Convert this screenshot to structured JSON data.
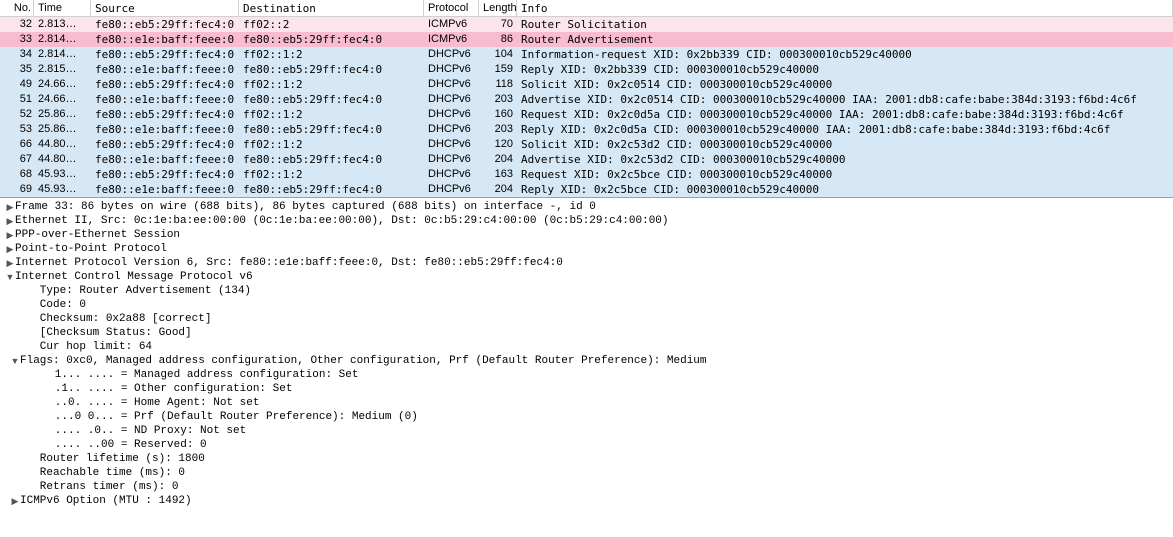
{
  "columns": [
    "No.",
    "Time",
    "Source",
    "Destination",
    "Protocol",
    "Length",
    "Info"
  ],
  "packets": [
    {
      "no": "32",
      "time": "2.813…",
      "src": "fe80::eb5:29ff:fec4:0",
      "dst": "ff02::2",
      "proto": "ICMPv6",
      "len": "70",
      "info": "Router Solicitation",
      "cls": "row-pink"
    },
    {
      "no": "33",
      "time": "2.814…",
      "src": "fe80::e1e:baff:feee:0",
      "dst": "fe80::eb5:29ff:fec4:0",
      "proto": "ICMPv6",
      "len": "86",
      "info": "Router Advertisement",
      "cls": "row-pinksel"
    },
    {
      "no": "34",
      "time": "2.814…",
      "src": "fe80::eb5:29ff:fec4:0",
      "dst": "ff02::1:2",
      "proto": "DHCPv6",
      "len": "104",
      "info": "Information-request XID: 0x2bb339 CID: 000300010cb529c40000",
      "cls": "row-blue"
    },
    {
      "no": "35",
      "time": "2.815…",
      "src": "fe80::e1e:baff:feee:0",
      "dst": "fe80::eb5:29ff:fec4:0",
      "proto": "DHCPv6",
      "len": "159",
      "info": "Reply XID: 0x2bb339 CID: 000300010cb529c40000",
      "cls": "row-blue"
    },
    {
      "no": "49",
      "time": "24.66…",
      "src": "fe80::eb5:29ff:fec4:0",
      "dst": "ff02::1:2",
      "proto": "DHCPv6",
      "len": "118",
      "info": "Solicit XID: 0x2c0514 CID: 000300010cb529c40000",
      "cls": "row-blue"
    },
    {
      "no": "51",
      "time": "24.66…",
      "src": "fe80::e1e:baff:feee:0",
      "dst": "fe80::eb5:29ff:fec4:0",
      "proto": "DHCPv6",
      "len": "203",
      "info": "Advertise XID: 0x2c0514 CID: 000300010cb529c40000 IAA: 2001:db8:cafe:babe:384d:3193:f6bd:4c6f",
      "cls": "row-blue"
    },
    {
      "no": "52",
      "time": "25.86…",
      "src": "fe80::eb5:29ff:fec4:0",
      "dst": "ff02::1:2",
      "proto": "DHCPv6",
      "len": "160",
      "info": "Request XID: 0x2c0d5a CID: 000300010cb529c40000 IAA: 2001:db8:cafe:babe:384d:3193:f6bd:4c6f",
      "cls": "row-blue"
    },
    {
      "no": "53",
      "time": "25.86…",
      "src": "fe80::e1e:baff:feee:0",
      "dst": "fe80::eb5:29ff:fec4:0",
      "proto": "DHCPv6",
      "len": "203",
      "info": "Reply XID: 0x2c0d5a CID: 000300010cb529c40000 IAA: 2001:db8:cafe:babe:384d:3193:f6bd:4c6f",
      "cls": "row-blue"
    },
    {
      "no": "66",
      "time": "44.80…",
      "src": "fe80::eb5:29ff:fec4:0",
      "dst": "ff02::1:2",
      "proto": "DHCPv6",
      "len": "120",
      "info": "Solicit XID: 0x2c53d2 CID: 000300010cb529c40000",
      "cls": "row-blue"
    },
    {
      "no": "67",
      "time": "44.80…",
      "src": "fe80::e1e:baff:feee:0",
      "dst": "fe80::eb5:29ff:fec4:0",
      "proto": "DHCPv6",
      "len": "204",
      "info": "Advertise XID: 0x2c53d2 CID: 000300010cb529c40000",
      "cls": "row-blue"
    },
    {
      "no": "68",
      "time": "45.93…",
      "src": "fe80::eb5:29ff:fec4:0",
      "dst": "ff02::1:2",
      "proto": "DHCPv6",
      "len": "163",
      "info": "Request XID: 0x2c5bce CID: 000300010cb529c40000",
      "cls": "row-blue"
    },
    {
      "no": "69",
      "time": "45.93…",
      "src": "fe80::e1e:baff:feee:0",
      "dst": "fe80::eb5:29ff:fec4:0",
      "proto": "DHCPv6",
      "len": "204",
      "info": "Reply XID: 0x2c5bce CID: 000300010cb529c40000",
      "cls": "row-blue"
    }
  ],
  "detail_lines": [
    {
      "lvl": 0,
      "tw": "▶",
      "txt": "Frame 33: 86 bytes on wire (688 bits), 86 bytes captured (688 bits) on interface -, id 0"
    },
    {
      "lvl": 0,
      "tw": "▶",
      "txt": "Ethernet II, Src: 0c:1e:ba:ee:00:00 (0c:1e:ba:ee:00:00), Dst: 0c:b5:29:c4:00:00 (0c:b5:29:c4:00:00)"
    },
    {
      "lvl": 0,
      "tw": "▶",
      "txt": "PPP-over-Ethernet Session"
    },
    {
      "lvl": 0,
      "tw": "▶",
      "txt": "Point-to-Point Protocol"
    },
    {
      "lvl": 0,
      "tw": "▶",
      "txt": "Internet Protocol Version 6, Src: fe80::e1e:baff:feee:0, Dst: fe80::eb5:29ff:fec4:0"
    },
    {
      "lvl": 0,
      "tw": "▼",
      "txt": "Internet Control Message Protocol v6"
    },
    {
      "lvl": 1,
      "tw": "",
      "txt": "   Type: Router Advertisement (134)"
    },
    {
      "lvl": 1,
      "tw": "",
      "txt": "   Code: 0"
    },
    {
      "lvl": 1,
      "tw": "",
      "txt": "   Checksum: 0x2a88 [correct]"
    },
    {
      "lvl": 1,
      "tw": "",
      "txt": "   [Checksum Status: Good]"
    },
    {
      "lvl": 1,
      "tw": "",
      "txt": "   Cur hop limit: 64"
    },
    {
      "lvl": 1,
      "tw": "▼",
      "txt": "Flags: 0xc0, Managed address configuration, Other configuration, Prf (Default Router Preference): Medium"
    },
    {
      "lvl": 2,
      "tw": "",
      "txt": "   1... .... = Managed address configuration: Set"
    },
    {
      "lvl": 2,
      "tw": "",
      "txt": "   .1.. .... = Other configuration: Set"
    },
    {
      "lvl": 2,
      "tw": "",
      "txt": "   ..0. .... = Home Agent: Not set"
    },
    {
      "lvl": 2,
      "tw": "",
      "txt": "   ...0 0... = Prf (Default Router Preference): Medium (0)"
    },
    {
      "lvl": 2,
      "tw": "",
      "txt": "   .... .0.. = ND Proxy: Not set"
    },
    {
      "lvl": 2,
      "tw": "",
      "txt": "   .... ..00 = Reserved: 0"
    },
    {
      "lvl": 1,
      "tw": "",
      "txt": "   Router lifetime (s): 1800"
    },
    {
      "lvl": 1,
      "tw": "",
      "txt": "   Reachable time (ms): 0"
    },
    {
      "lvl": 1,
      "tw": "",
      "txt": "   Retrans timer (ms): 0"
    },
    {
      "lvl": 1,
      "tw": "▶",
      "txt": "ICMPv6 Option (MTU : 1492)"
    }
  ]
}
